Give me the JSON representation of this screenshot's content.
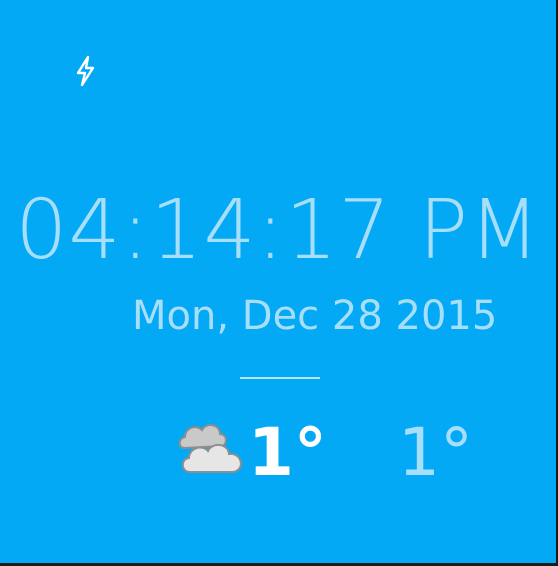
{
  "status": {
    "charging_icon": "lightning-bolt-icon"
  },
  "clock": {
    "time": "04:14:17 PM",
    "date": "Mon, Dec 28 2015"
  },
  "weather": {
    "condition_icon": "cloudy-icon",
    "temp_high": "1°",
    "temp_low": "1°"
  },
  "colors": {
    "background": "#03a9f4",
    "primary_text": "#a7dffb",
    "accent_text": "#ffffff"
  }
}
